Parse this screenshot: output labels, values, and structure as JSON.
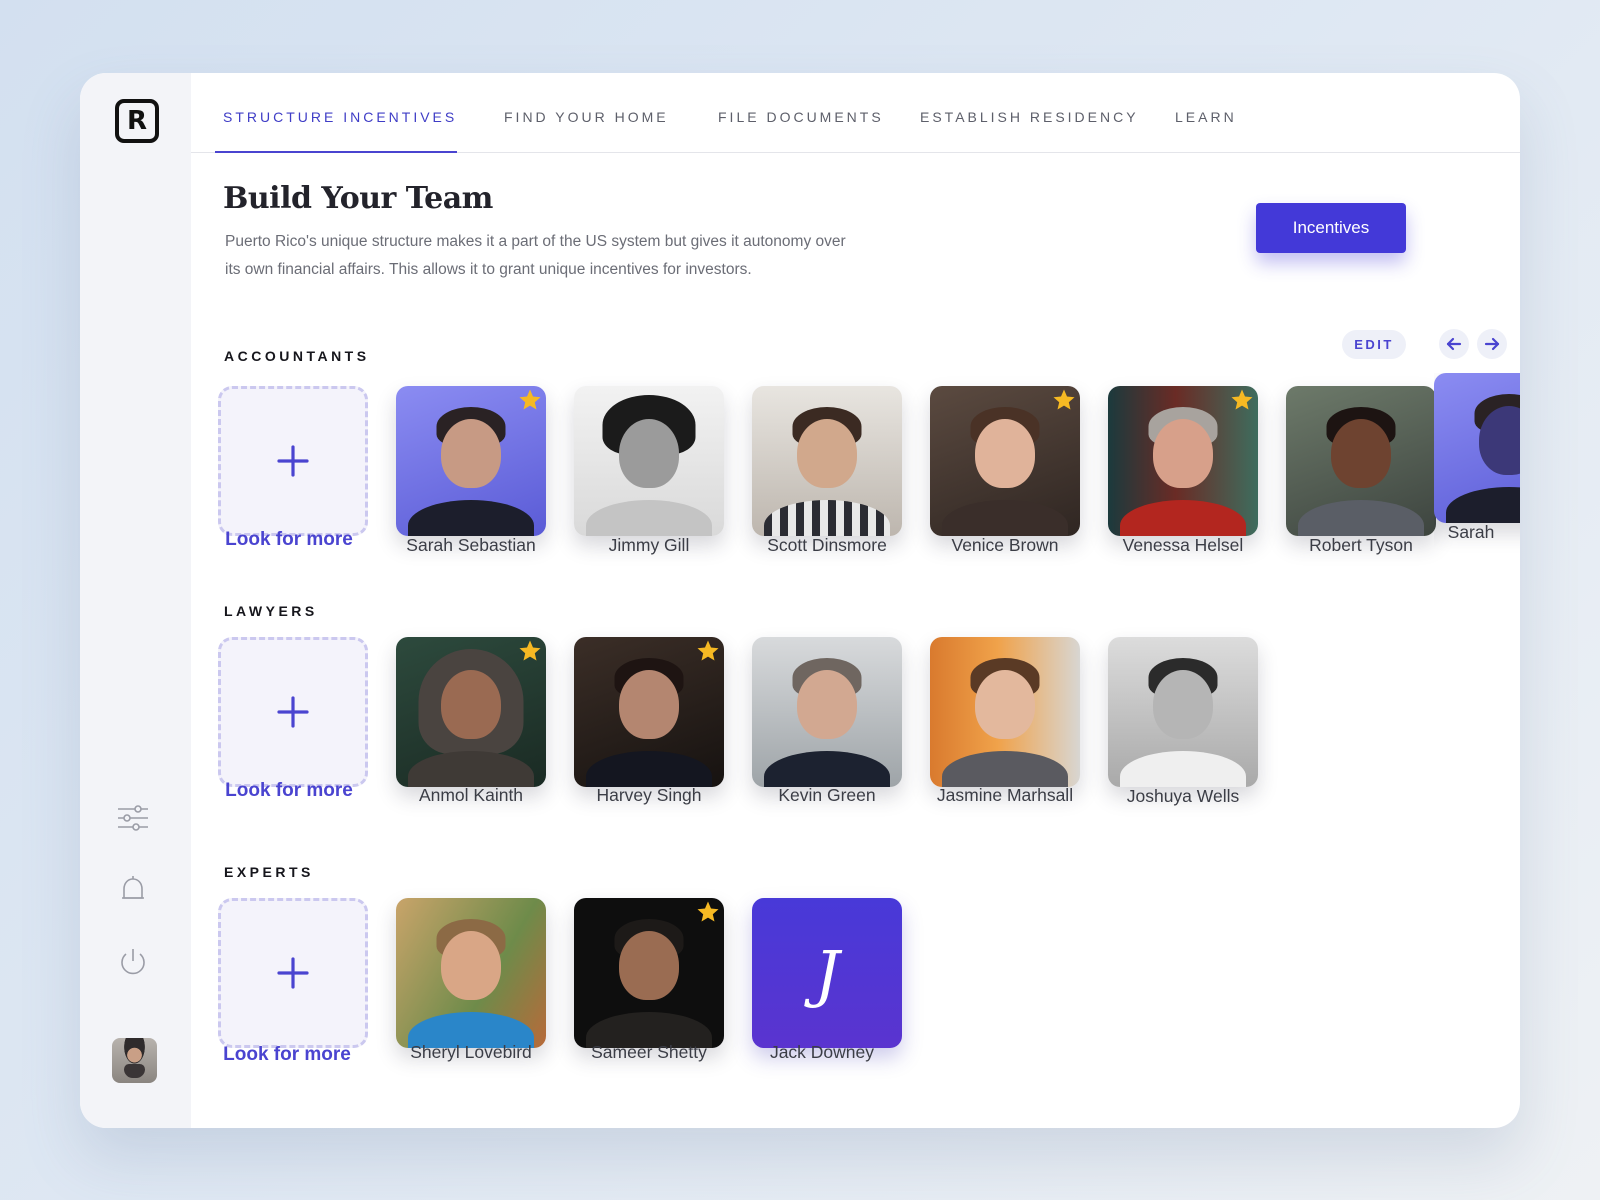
{
  "app": {
    "logo_letter": "R",
    "accent_color": "#4339d8",
    "icons": [
      "sliders-icon",
      "bell-icon",
      "power-icon"
    ]
  },
  "nav": {
    "tabs": [
      {
        "label": "STRUCTURE INCENTIVES",
        "active": true
      },
      {
        "label": "FIND YOUR HOME",
        "active": false
      },
      {
        "label": "FILE DOCUMENTS",
        "active": false
      },
      {
        "label": "ESTABLISH RESIDENCY",
        "active": false
      },
      {
        "label": "LEARN",
        "active": false
      }
    ]
  },
  "header": {
    "title": "Build Your Team",
    "description": "Puerto Rico's unique structure makes it a part of the US system but gives it autonomy over its own financial affairs. This allows it to grant unique incentives for investors.",
    "cta_label": "Incentives"
  },
  "controls": {
    "edit_label": "EDIT",
    "prev_icon": "arrow-left-icon",
    "next_icon": "arrow-right-icon"
  },
  "sections": {
    "accountants": {
      "title": "ACCOUNTANTS",
      "look_more": "Look for more",
      "people": [
        {
          "name": "Sarah Sebastian",
          "starred": true
        },
        {
          "name": "Jimmy Gill",
          "starred": false
        },
        {
          "name": "Scott Dinsmore",
          "starred": false
        },
        {
          "name": "Venice Brown",
          "starred": true
        },
        {
          "name": "Venessa Helsel",
          "starred": true
        },
        {
          "name": "Robert Tyson",
          "starred": false
        },
        {
          "name": "Sarah",
          "starred": false
        }
      ]
    },
    "lawyers": {
      "title": "LAWYERS",
      "look_more": "Look for more",
      "people": [
        {
          "name": "Anmol Kainth",
          "starred": true
        },
        {
          "name": "Harvey Singh",
          "starred": true
        },
        {
          "name": "Kevin Green",
          "starred": false
        },
        {
          "name": "Jasmine Marhsall",
          "starred": false
        },
        {
          "name": "Joshuya Wells",
          "starred": false
        }
      ]
    },
    "experts": {
      "title": "EXPERTS",
      "look_more": "Look for more",
      "people": [
        {
          "name": "Sheryl Lovebird",
          "starred": false
        },
        {
          "name": "Sameer Shetty",
          "starred": true
        },
        {
          "name": "Jack Downey",
          "starred": false,
          "logo_glyph": "J"
        }
      ]
    }
  }
}
